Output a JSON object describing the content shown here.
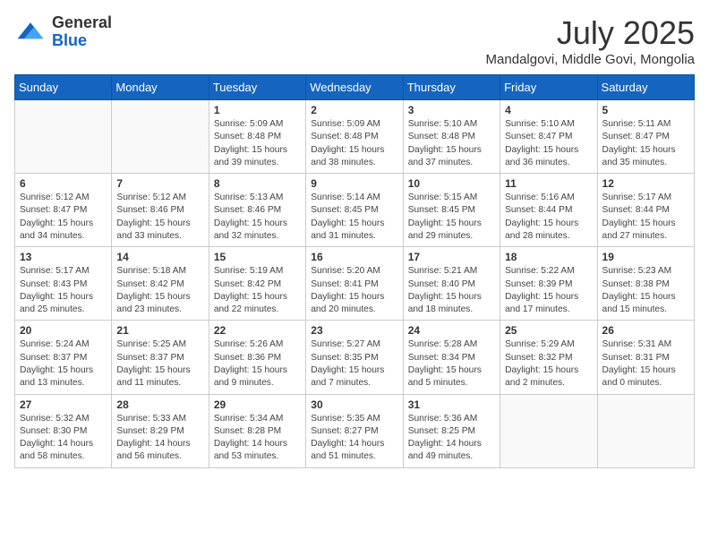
{
  "logo": {
    "general": "General",
    "blue": "Blue"
  },
  "title": "July 2025",
  "location": "Mandalgovi, Middle Govi, Mongolia",
  "headers": [
    "Sunday",
    "Monday",
    "Tuesday",
    "Wednesday",
    "Thursday",
    "Friday",
    "Saturday"
  ],
  "weeks": [
    [
      {
        "day": "",
        "info": ""
      },
      {
        "day": "",
        "info": ""
      },
      {
        "day": "1",
        "info": "Sunrise: 5:09 AM\nSunset: 8:48 PM\nDaylight: 15 hours and 39 minutes."
      },
      {
        "day": "2",
        "info": "Sunrise: 5:09 AM\nSunset: 8:48 PM\nDaylight: 15 hours and 38 minutes."
      },
      {
        "day": "3",
        "info": "Sunrise: 5:10 AM\nSunset: 8:48 PM\nDaylight: 15 hours and 37 minutes."
      },
      {
        "day": "4",
        "info": "Sunrise: 5:10 AM\nSunset: 8:47 PM\nDaylight: 15 hours and 36 minutes."
      },
      {
        "day": "5",
        "info": "Sunrise: 5:11 AM\nSunset: 8:47 PM\nDaylight: 15 hours and 35 minutes."
      }
    ],
    [
      {
        "day": "6",
        "info": "Sunrise: 5:12 AM\nSunset: 8:47 PM\nDaylight: 15 hours and 34 minutes."
      },
      {
        "day": "7",
        "info": "Sunrise: 5:12 AM\nSunset: 8:46 PM\nDaylight: 15 hours and 33 minutes."
      },
      {
        "day": "8",
        "info": "Sunrise: 5:13 AM\nSunset: 8:46 PM\nDaylight: 15 hours and 32 minutes."
      },
      {
        "day": "9",
        "info": "Sunrise: 5:14 AM\nSunset: 8:45 PM\nDaylight: 15 hours and 31 minutes."
      },
      {
        "day": "10",
        "info": "Sunrise: 5:15 AM\nSunset: 8:45 PM\nDaylight: 15 hours and 29 minutes."
      },
      {
        "day": "11",
        "info": "Sunrise: 5:16 AM\nSunset: 8:44 PM\nDaylight: 15 hours and 28 minutes."
      },
      {
        "day": "12",
        "info": "Sunrise: 5:17 AM\nSunset: 8:44 PM\nDaylight: 15 hours and 27 minutes."
      }
    ],
    [
      {
        "day": "13",
        "info": "Sunrise: 5:17 AM\nSunset: 8:43 PM\nDaylight: 15 hours and 25 minutes."
      },
      {
        "day": "14",
        "info": "Sunrise: 5:18 AM\nSunset: 8:42 PM\nDaylight: 15 hours and 23 minutes."
      },
      {
        "day": "15",
        "info": "Sunrise: 5:19 AM\nSunset: 8:42 PM\nDaylight: 15 hours and 22 minutes."
      },
      {
        "day": "16",
        "info": "Sunrise: 5:20 AM\nSunset: 8:41 PM\nDaylight: 15 hours and 20 minutes."
      },
      {
        "day": "17",
        "info": "Sunrise: 5:21 AM\nSunset: 8:40 PM\nDaylight: 15 hours and 18 minutes."
      },
      {
        "day": "18",
        "info": "Sunrise: 5:22 AM\nSunset: 8:39 PM\nDaylight: 15 hours and 17 minutes."
      },
      {
        "day": "19",
        "info": "Sunrise: 5:23 AM\nSunset: 8:38 PM\nDaylight: 15 hours and 15 minutes."
      }
    ],
    [
      {
        "day": "20",
        "info": "Sunrise: 5:24 AM\nSunset: 8:37 PM\nDaylight: 15 hours and 13 minutes."
      },
      {
        "day": "21",
        "info": "Sunrise: 5:25 AM\nSunset: 8:37 PM\nDaylight: 15 hours and 11 minutes."
      },
      {
        "day": "22",
        "info": "Sunrise: 5:26 AM\nSunset: 8:36 PM\nDaylight: 15 hours and 9 minutes."
      },
      {
        "day": "23",
        "info": "Sunrise: 5:27 AM\nSunset: 8:35 PM\nDaylight: 15 hours and 7 minutes."
      },
      {
        "day": "24",
        "info": "Sunrise: 5:28 AM\nSunset: 8:34 PM\nDaylight: 15 hours and 5 minutes."
      },
      {
        "day": "25",
        "info": "Sunrise: 5:29 AM\nSunset: 8:32 PM\nDaylight: 15 hours and 2 minutes."
      },
      {
        "day": "26",
        "info": "Sunrise: 5:31 AM\nSunset: 8:31 PM\nDaylight: 15 hours and 0 minutes."
      }
    ],
    [
      {
        "day": "27",
        "info": "Sunrise: 5:32 AM\nSunset: 8:30 PM\nDaylight: 14 hours and 58 minutes."
      },
      {
        "day": "28",
        "info": "Sunrise: 5:33 AM\nSunset: 8:29 PM\nDaylight: 14 hours and 56 minutes."
      },
      {
        "day": "29",
        "info": "Sunrise: 5:34 AM\nSunset: 8:28 PM\nDaylight: 14 hours and 53 minutes."
      },
      {
        "day": "30",
        "info": "Sunrise: 5:35 AM\nSunset: 8:27 PM\nDaylight: 14 hours and 51 minutes."
      },
      {
        "day": "31",
        "info": "Sunrise: 5:36 AM\nSunset: 8:25 PM\nDaylight: 14 hours and 49 minutes."
      },
      {
        "day": "",
        "info": ""
      },
      {
        "day": "",
        "info": ""
      }
    ]
  ]
}
